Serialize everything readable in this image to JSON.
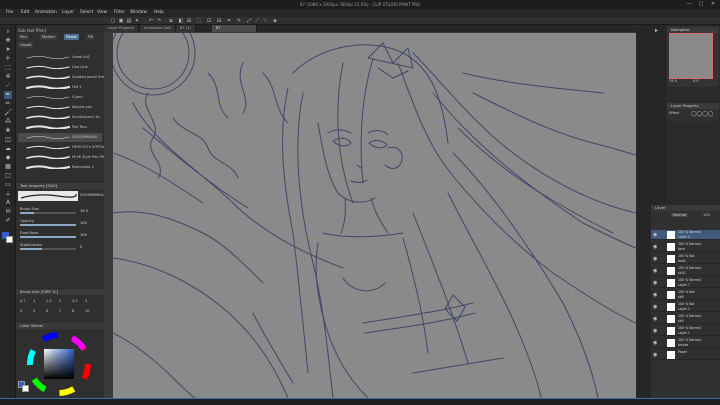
{
  "window": {
    "title": "87 (1080 x 1920px 300dpi 15.0%) - CLIP STUDIO PAINT PRO",
    "controls": [
      "—",
      "□",
      "✕"
    ]
  },
  "menu": [
    "File",
    "Edit",
    "Animation",
    "Layer",
    "Select",
    "View",
    "Filter",
    "Window",
    "Help"
  ],
  "toolbar_icons": [
    "new-icon",
    "open-icon",
    "save-icon",
    "undo-icon",
    "redo-icon",
    "clear-icon",
    "fill-icon",
    "transform-icon",
    "snap-icon",
    "ruler-icon",
    "select-all-icon",
    "deselect-icon",
    "invert-icon",
    "crop-icon",
    "pen-icon",
    "transform-selection-icon",
    "snap-ruler-icon",
    "snap-grid-icon",
    "snap-special-icon",
    "color-icon"
  ],
  "subtool": {
    "header": "Sub tool [Pen]",
    "tabs": [
      "Pen",
      "Marker",
      "Pastel",
      "Fill",
      "Liquid"
    ],
    "brushes": [
      {
        "name": "Lineal ilu2",
        "selected": false
      },
      {
        "name": "Line Line",
        "selected": false
      },
      {
        "name": "Spotted pencil liner2",
        "selected": false
      },
      {
        "name": "Felt 1",
        "selected": false
      },
      {
        "name": "G-pen",
        "selected": false
      },
      {
        "name": "Kabura pen",
        "selected": false
      },
      {
        "name": "Scratchpen1.1b",
        "selected": false
      },
      {
        "name": "Pen Tenz",
        "selected": false
      },
      {
        "name": "SAOSEMMILVA",
        "selected": true
      },
      {
        "name": "HEVECUT4 SOFTrack",
        "selected": false
      },
      {
        "name": "Mi Mi Style Pen 99 gentle",
        "selected": false
      },
      {
        "name": "Ralencolor 2",
        "selected": false
      }
    ]
  },
  "tool_property": {
    "header": "Tool property [SAO]",
    "brush_name": "SAOSEMMILVA",
    "rows": [
      {
        "label": "Brush Size",
        "value": "10.0",
        "fraction": 0.25
      },
      {
        "label": "Opacity",
        "value": "100",
        "fraction": 1.0
      },
      {
        "label": "Flow Haze",
        "value": "100",
        "fraction": 1.0
      },
      {
        "label": "Stabilization",
        "value": "5",
        "fraction": 0.4
      }
    ]
  },
  "brush_size_panel": {
    "header": "Brush size [SIZE 1L]",
    "sizes_row1": [
      "0.7",
      "1",
      "1.5",
      "2",
      "2.5",
      "3"
    ],
    "sizes_row2": [
      "4",
      "5",
      "6",
      "7",
      "8",
      "10"
    ]
  },
  "color_panel": {
    "header": "Color Wheel",
    "main_color": "#2d5ec9",
    "sub_color": "#ffffff"
  },
  "doc_tabs": [
    {
      "label": "Layer Property",
      "active": false
    },
    {
      "label": "Animation Cels",
      "active": false
    },
    {
      "label": "87 (1)",
      "active": false
    },
    {
      "label": "87",
      "active": true
    }
  ],
  "navigator": {
    "header": "Navigator",
    "zoom": "15.0",
    "angle": "0.0"
  },
  "layer_property": {
    "header": "Layer Property",
    "effect": "Effect"
  },
  "layers_panel": {
    "header": "Layer",
    "blend_mode": "Normal",
    "opacity": "100",
    "layers": [
      {
        "name": "100 % Normal\nLayer 4",
        "selected": true,
        "thumb": "#ffffff"
      },
      {
        "name": "100 % Normal\nface",
        "selected": false,
        "thumb": "#ffffff"
      },
      {
        "name": "100 % Nor\nbody",
        "selected": false,
        "thumb": "#ffffff"
      },
      {
        "name": "100 % Normal\nsk10",
        "selected": false,
        "thumb": "#ffffff"
      },
      {
        "name": "100 % Normal\nLayer 7",
        "selected": false,
        "thumb": "#ffffff"
      },
      {
        "name": "100 % Nor\nsk8",
        "selected": false,
        "thumb": "#ffffff"
      },
      {
        "name": "100 % Nor\nLayer 1",
        "selected": false,
        "thumb": "#ffffff"
      },
      {
        "name": "100 % Normal\nsk5",
        "selected": false,
        "thumb": "#ffffff"
      },
      {
        "name": "100 % Normal\nLayer 1",
        "selected": false,
        "thumb": "#ffffff"
      },
      {
        "name": "100 % Normal\nbrinda",
        "selected": false,
        "thumb": "#ffffff"
      },
      {
        "name": "Paper",
        "selected": false,
        "thumb": "#ffffff"
      }
    ]
  },
  "colors": {
    "accent": "#3f5a7a",
    "canvas_bg": "#8a8a8a",
    "line_art": "#3b3f66"
  }
}
